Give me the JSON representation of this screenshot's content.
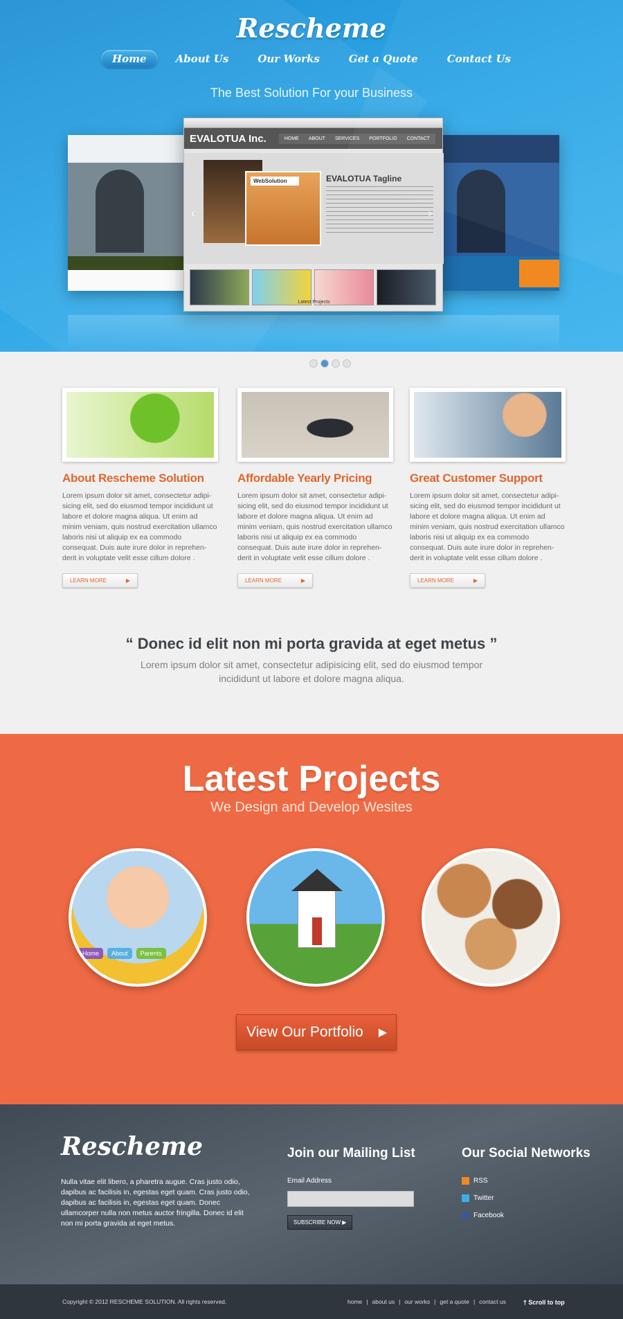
{
  "header": {
    "logo": "Rescheme",
    "nav": [
      "Home",
      "About Us",
      "Our Works",
      "Get a Quote",
      "Contact Us"
    ],
    "tagline": "The Best Solution For your Business"
  },
  "slider": {
    "brand": "EVALOTUA Inc.",
    "menu": [
      "HOME",
      "ABOUT",
      "SERVICES",
      "PORTFOLIO",
      "CONTACT"
    ],
    "title": "EVALOTUA Tagline",
    "thumb_label": "WebSolution",
    "caption": "Latest Projects",
    "active_slide": 2,
    "slides": 4
  },
  "features": [
    {
      "title": "About Rescheme Solution",
      "text": "Lorem ipsum dolor sit amet, consectetur adipi-sicing elit, sed do eiusmod tempor incididunt ut labore et dolore magna aliqua. Ut enim ad minim veniam, quis nostrud exercitation ullamco laboris nisi ut aliquip ex ea commodo consequat. Duis aute irure dolor in reprehen-derit in voluptate velit esse cillum dolore .",
      "button": "LEARN MORE"
    },
    {
      "title": "Affordable Yearly Pricing",
      "text": "Lorem ipsum dolor sit amet, consectetur adipi-sicing elit, sed do eiusmod tempor incididunt ut labore et dolore magna aliqua. Ut enim ad minim veniam, quis nostrud exercitation ullamco laboris nisi ut aliquip ex ea commodo consequat. Duis aute irure dolor in reprehen-derit in voluptate velit esse cillum dolore .",
      "button": "LEARN MORE"
    },
    {
      "title": "Great Customer Support",
      "text": "Lorem ipsum dolor sit amet, consectetur adipi-sicing elit, sed do eiusmod tempor incididunt ut labore et dolore magna aliqua. Ut enim ad minim veniam, quis nostrud exercitation ullamco laboris nisi ut aliquip ex ea commodo consequat. Duis aute irure dolor in reprehen-derit in voluptate velit esse cillum dolore .",
      "button": "LEARN MORE"
    }
  ],
  "quote": {
    "text": "“ Donec id elit non mi porta gravida at eget metus ”",
    "sub": "Lorem ipsum dolor sit amet, consectetur adipisicing elit, sed do eiusmod tempor incididunt ut labore et dolore magna aliqua."
  },
  "projects": {
    "title": "Latest Projects",
    "subtitle": "We Design and Develop Wesites",
    "circle1_buttons": [
      "Home",
      "About",
      "Parents"
    ],
    "portfolio_button": "View Our Portfolio"
  },
  "footer": {
    "logo": "Rescheme",
    "description": "Nulla vitae elit libero, a pharetra augue. Cras justo odio, dapibus ac facilisis in, egestas eget quam. Cras justo odio, dapibus ac facilisis in, egestas eget quam. Donec ullamcorper nulla non metus auctor fringilla. Donec id elit non mi porta gravida at eget metus.",
    "mailing_title": "Join our Mailing List",
    "email_label": "Email Address",
    "email_value": "",
    "subscribe": "SUBSCRIBE NOW",
    "social_title": "Our Social Networks",
    "social": [
      "RSS",
      "Twitter",
      "Facebook"
    ]
  },
  "bottom": {
    "copyright": "Copyright © 2012 RESCHEME SOLUTION. All rights reserved.",
    "links": [
      "home",
      "about us",
      "our works",
      "get a quote",
      "contact us"
    ],
    "scroll_top": "Scroll to top"
  },
  "colors": {
    "accent": "#ee6a45",
    "blue": "#2ea6e6",
    "footer": "#4a545e"
  }
}
